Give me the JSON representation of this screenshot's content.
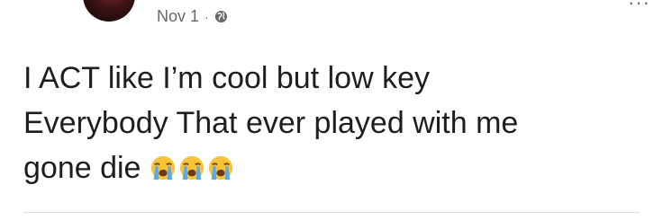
{
  "post": {
    "timestamp": "Nov 1",
    "separator": "·",
    "privacy_icon": "globe-icon",
    "lines": [
      "I ACT like I’m cool but low key",
      "Everybody That ever played with me",
      "gone die"
    ],
    "emojis": [
      "loudly-crying-face",
      "loudly-crying-face",
      "loudly-crying-face"
    ]
  },
  "colors": {
    "text": "#1c1e21",
    "meta": "#65676b",
    "emoji_face": "#f7c23a",
    "emoji_tears": "#5aa9e6"
  }
}
